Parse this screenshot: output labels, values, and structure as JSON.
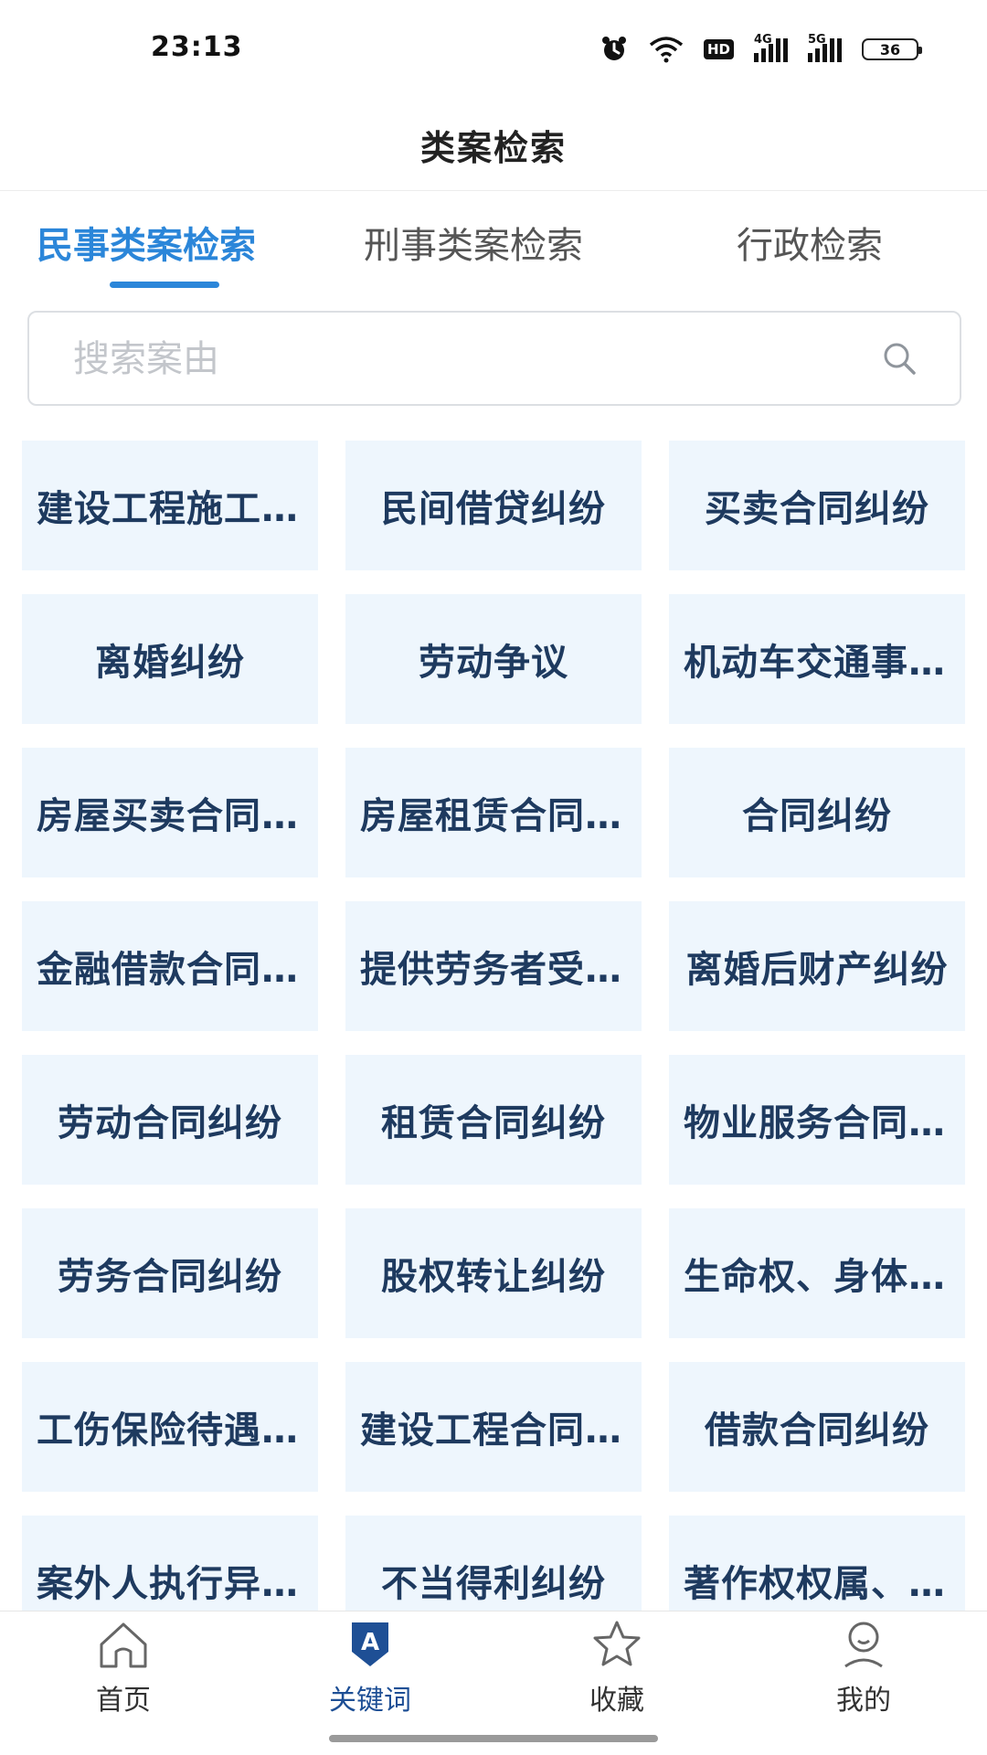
{
  "status": {
    "time": "23:13",
    "hd": "HD",
    "net1": "4G",
    "net2": "5G",
    "battery": "36"
  },
  "header": {
    "title": "类案检索"
  },
  "tabs": [
    {
      "label": "民事类案检索",
      "active": true
    },
    {
      "label": "刑事类案检索",
      "active": false
    },
    {
      "label": "行政检索",
      "active": false
    }
  ],
  "search": {
    "placeholder": "搜索案由",
    "value": ""
  },
  "cases": [
    "建设工程施工合同纠纷",
    "民间借贷纠纷",
    "买卖合同纠纷",
    "离婚纠纷",
    "劳动争议",
    "机动车交通事故责任纠纷",
    "房屋买卖合同纠纷",
    "房屋租赁合同纠纷",
    "合同纠纷",
    "金融借款合同纠纷",
    "提供劳务者受害责任纠纷",
    "离婚后财产纠纷",
    "劳动合同纠纷",
    "租赁合同纠纷",
    "物业服务合同纠纷",
    "劳务合同纠纷",
    "股权转让纠纷",
    "生命权、身体权、健康权纠纷",
    "工伤保险待遇纠纷",
    "建设工程合同纠纷",
    "借款合同纠纷",
    "案外人执行异议之诉",
    "不当得利纠纷",
    "著作权权属、侵权纠纷"
  ],
  "bottom_nav": [
    {
      "label": "首页",
      "icon": "home-icon",
      "active": false
    },
    {
      "label": "关键词",
      "icon": "keyword-icon",
      "active": true
    },
    {
      "label": "收藏",
      "icon": "star-icon",
      "active": false
    },
    {
      "label": "我的",
      "icon": "user-icon",
      "active": false
    }
  ],
  "colors": {
    "accent": "#2b86d9",
    "card_bg": "#eef6fd",
    "card_text": "#1e3a5f",
    "nav_active": "#1e4f95"
  }
}
